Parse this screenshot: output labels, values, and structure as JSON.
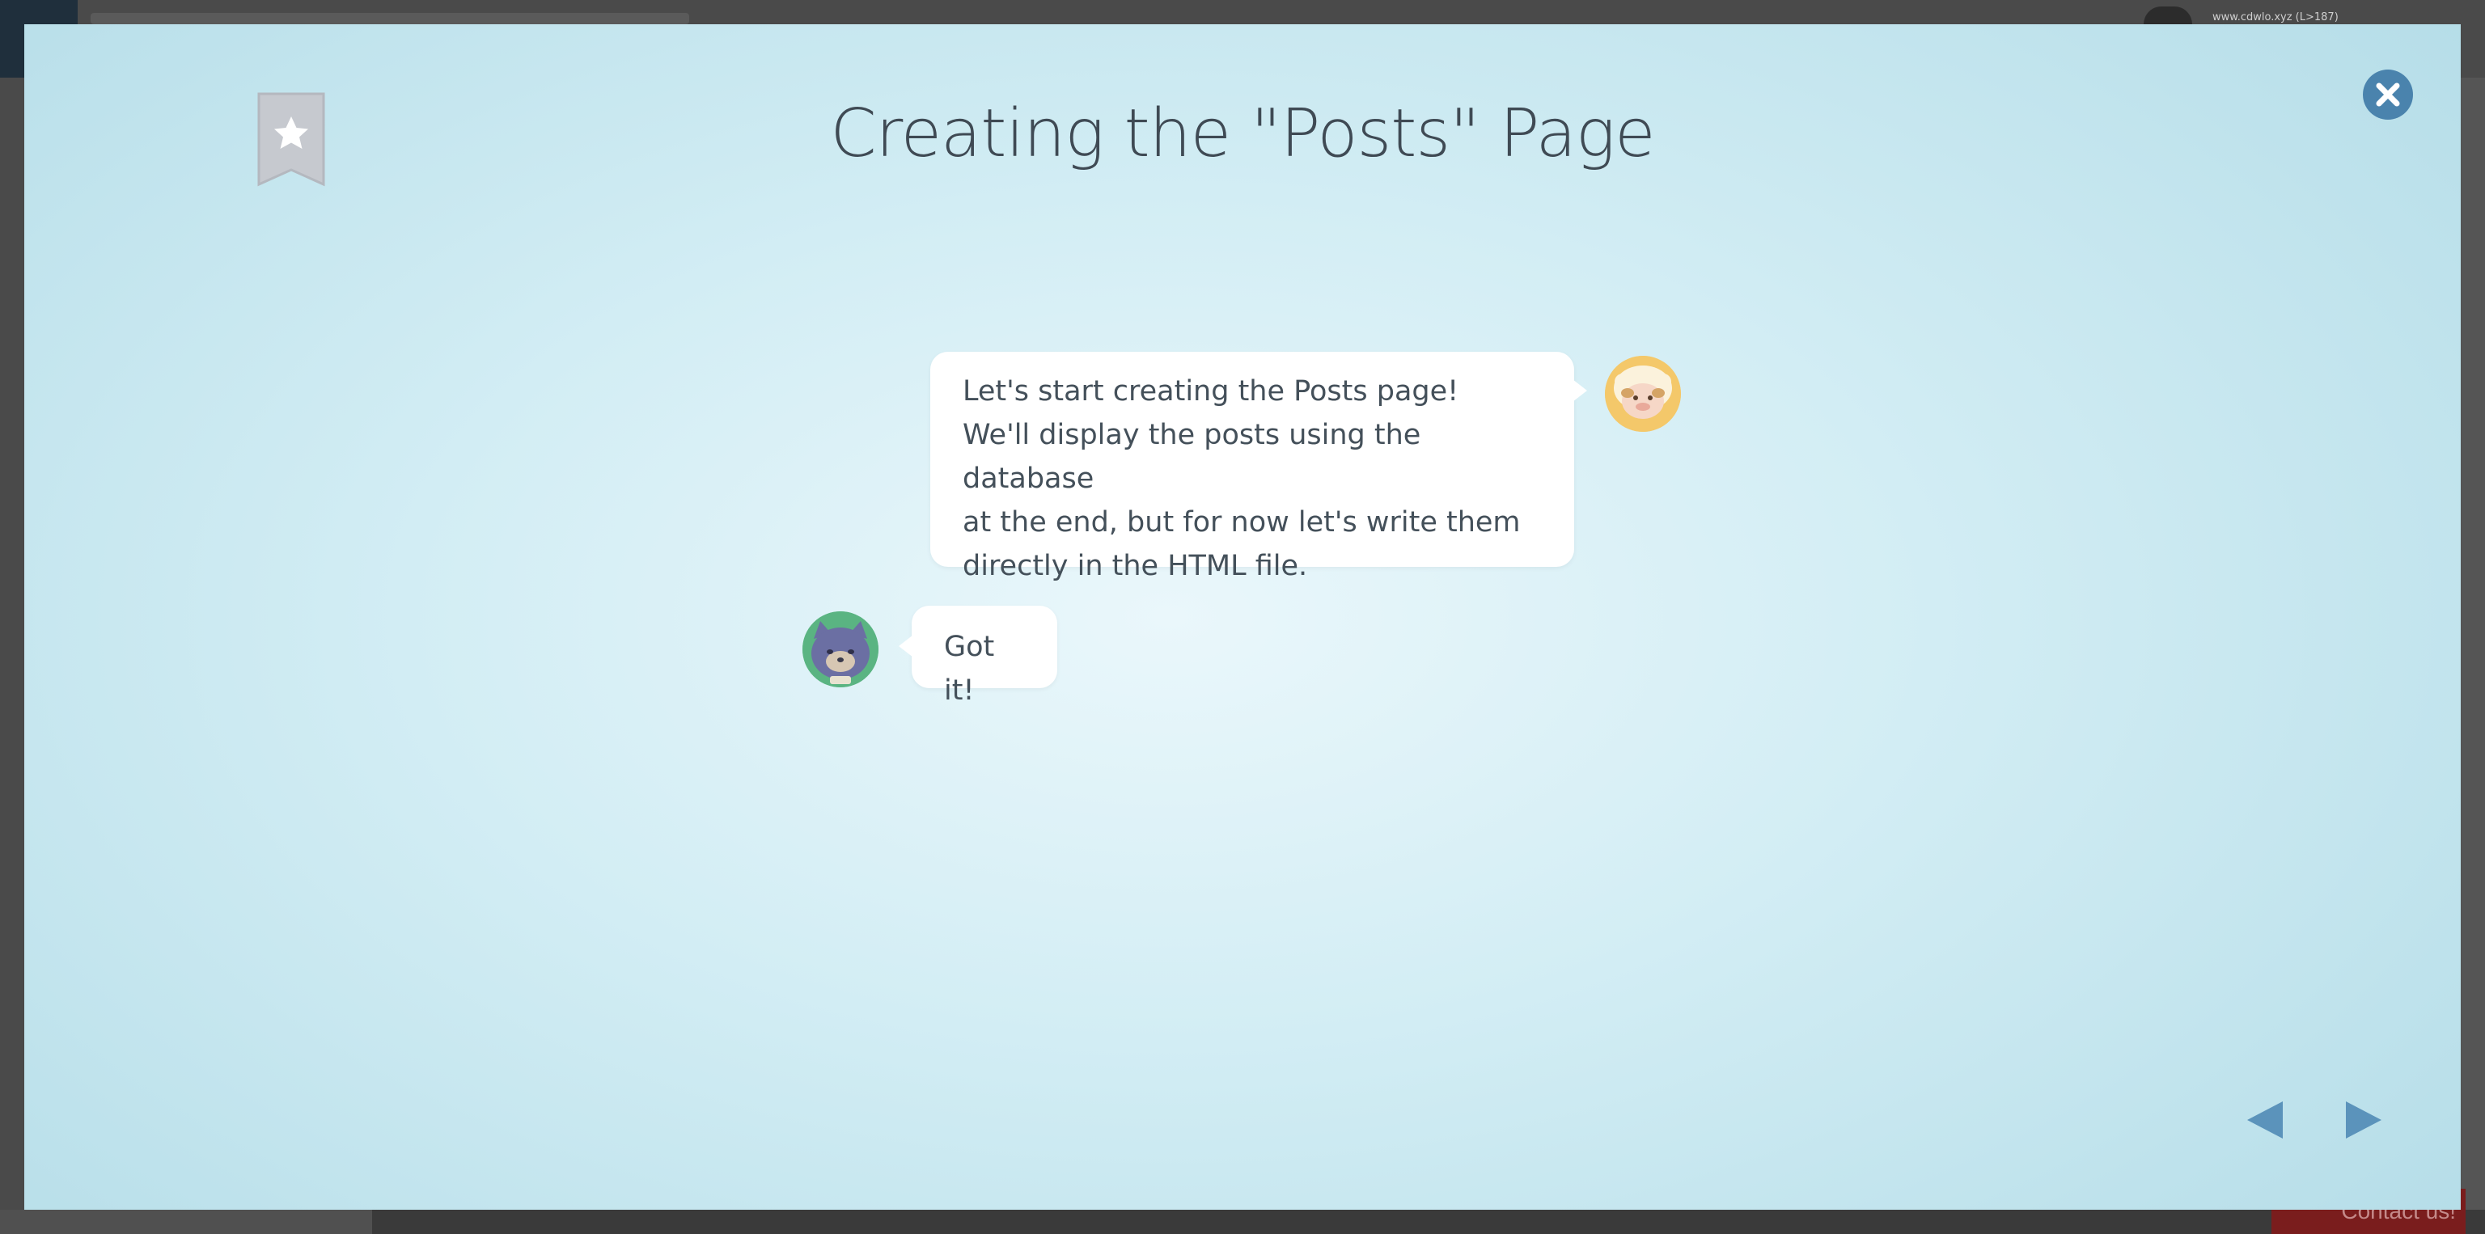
{
  "background": {
    "user_text": "www.cdwlo.xyz (L>187)",
    "contact_label": "Contact us!"
  },
  "lesson": {
    "title": "Creating the \"Posts\" Page"
  },
  "chat": {
    "messages": [
      {
        "speaker": "sheep",
        "lines": [
          "Let's start creating the Posts page!",
          "We'll display the posts using the database",
          "at the end, but for now let's write them",
          "directly in the HTML file."
        ]
      },
      {
        "speaker": "cat",
        "lines": [
          "Got it!"
        ]
      }
    ]
  },
  "icons": {
    "bookmark": "bookmark-star-icon",
    "close": "close-icon",
    "prev": "prev-arrow-icon",
    "next": "next-arrow-icon"
  },
  "colors": {
    "accent": "#4a83ad",
    "arrow": "#5b93bb",
    "title": "#3f4a54",
    "bookmark": "#c6c9cf"
  }
}
